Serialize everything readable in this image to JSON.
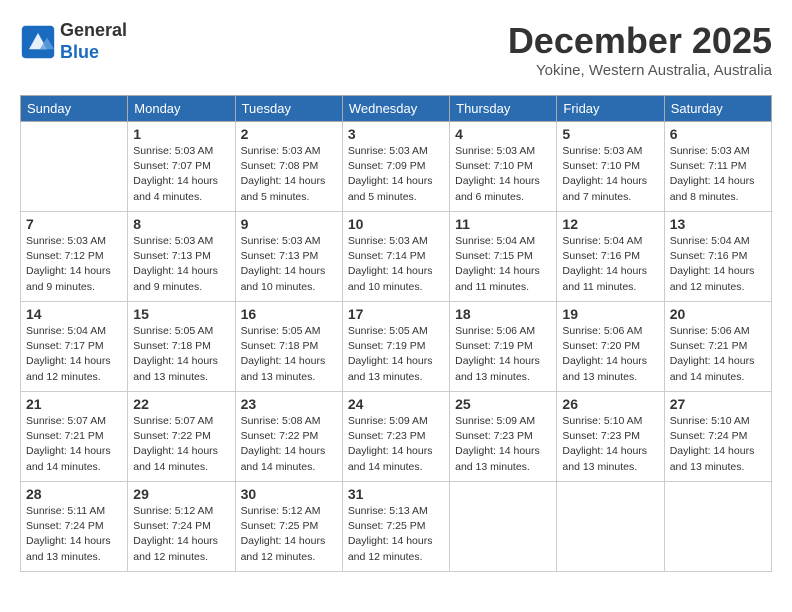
{
  "header": {
    "logo_line1": "General",
    "logo_line2": "Blue",
    "month": "December 2025",
    "location": "Yokine, Western Australia, Australia"
  },
  "weekdays": [
    "Sunday",
    "Monday",
    "Tuesday",
    "Wednesday",
    "Thursday",
    "Friday",
    "Saturday"
  ],
  "weeks": [
    [
      {
        "day": "",
        "info": ""
      },
      {
        "day": "1",
        "info": "Sunrise: 5:03 AM\nSunset: 7:07 PM\nDaylight: 14 hours\nand 4 minutes."
      },
      {
        "day": "2",
        "info": "Sunrise: 5:03 AM\nSunset: 7:08 PM\nDaylight: 14 hours\nand 5 minutes."
      },
      {
        "day": "3",
        "info": "Sunrise: 5:03 AM\nSunset: 7:09 PM\nDaylight: 14 hours\nand 5 minutes."
      },
      {
        "day": "4",
        "info": "Sunrise: 5:03 AM\nSunset: 7:10 PM\nDaylight: 14 hours\nand 6 minutes."
      },
      {
        "day": "5",
        "info": "Sunrise: 5:03 AM\nSunset: 7:10 PM\nDaylight: 14 hours\nand 7 minutes."
      },
      {
        "day": "6",
        "info": "Sunrise: 5:03 AM\nSunset: 7:11 PM\nDaylight: 14 hours\nand 8 minutes."
      }
    ],
    [
      {
        "day": "7",
        "info": ""
      },
      {
        "day": "8",
        "info": "Sunrise: 5:03 AM\nSunset: 7:13 PM\nDaylight: 14 hours\nand 9 minutes."
      },
      {
        "day": "9",
        "info": "Sunrise: 5:03 AM\nSunset: 7:13 PM\nDaylight: 14 hours\nand 10 minutes."
      },
      {
        "day": "10",
        "info": "Sunrise: 5:03 AM\nSunset: 7:14 PM\nDaylight: 14 hours\nand 10 minutes."
      },
      {
        "day": "11",
        "info": "Sunrise: 5:04 AM\nSunset: 7:15 PM\nDaylight: 14 hours\nand 11 minutes."
      },
      {
        "day": "12",
        "info": "Sunrise: 5:04 AM\nSunset: 7:16 PM\nDaylight: 14 hours\nand 11 minutes."
      },
      {
        "day": "13",
        "info": "Sunrise: 5:04 AM\nSunset: 7:16 PM\nDaylight: 14 hours\nand 12 minutes."
      }
    ],
    [
      {
        "day": "14",
        "info": ""
      },
      {
        "day": "15",
        "info": "Sunrise: 5:05 AM\nSunset: 7:18 PM\nDaylight: 14 hours\nand 13 minutes."
      },
      {
        "day": "16",
        "info": "Sunrise: 5:05 AM\nSunset: 7:18 PM\nDaylight: 14 hours\nand 13 minutes."
      },
      {
        "day": "17",
        "info": "Sunrise: 5:05 AM\nSunset: 7:19 PM\nDaylight: 14 hours\nand 13 minutes."
      },
      {
        "day": "18",
        "info": "Sunrise: 5:06 AM\nSunset: 7:19 PM\nDaylight: 14 hours\nand 13 minutes."
      },
      {
        "day": "19",
        "info": "Sunrise: 5:06 AM\nSunset: 7:20 PM\nDaylight: 14 hours\nand 13 minutes."
      },
      {
        "day": "20",
        "info": "Sunrise: 5:06 AM\nSunset: 7:21 PM\nDaylight: 14 hours\nand 14 minutes."
      }
    ],
    [
      {
        "day": "21",
        "info": ""
      },
      {
        "day": "22",
        "info": "Sunrise: 5:07 AM\nSunset: 7:22 PM\nDaylight: 14 hours\nand 14 minutes."
      },
      {
        "day": "23",
        "info": "Sunrise: 5:08 AM\nSunset: 7:22 PM\nDaylight: 14 hours\nand 14 minutes."
      },
      {
        "day": "24",
        "info": "Sunrise: 5:09 AM\nSunset: 7:23 PM\nDaylight: 14 hours\nand 14 minutes."
      },
      {
        "day": "25",
        "info": "Sunrise: 5:09 AM\nSunset: 7:23 PM\nDaylight: 14 hours\nand 13 minutes."
      },
      {
        "day": "26",
        "info": "Sunrise: 5:10 AM\nSunset: 7:23 PM\nDaylight: 14 hours\nand 13 minutes."
      },
      {
        "day": "27",
        "info": "Sunrise: 5:10 AM\nSunset: 7:24 PM\nDaylight: 14 hours\nand 13 minutes."
      }
    ],
    [
      {
        "day": "28",
        "info": "Sunrise: 5:11 AM\nSunset: 7:24 PM\nDaylight: 14 hours\nand 13 minutes."
      },
      {
        "day": "29",
        "info": "Sunrise: 5:12 AM\nSunset: 7:24 PM\nDaylight: 14 hours\nand 12 minutes."
      },
      {
        "day": "30",
        "info": "Sunrise: 5:12 AM\nSunset: 7:25 PM\nDaylight: 14 hours\nand 12 minutes."
      },
      {
        "day": "31",
        "info": "Sunrise: 5:13 AM\nSunset: 7:25 PM\nDaylight: 14 hours\nand 12 minutes."
      },
      {
        "day": "",
        "info": ""
      },
      {
        "day": "",
        "info": ""
      },
      {
        "day": "",
        "info": ""
      }
    ]
  ],
  "week1_day7_info": "Sunrise: 5:03 AM\nSunset: 7:12 PM\nDaylight: 14 hours\nand 9 minutes.",
  "week3_day14_info": "Sunrise: 5:04 AM\nSunset: 7:17 PM\nDaylight: 14 hours\nand 12 minutes.",
  "week4_day21_info": "Sunrise: 5:07 AM\nSunset: 7:21 PM\nDaylight: 14 hours\nand 14 minutes."
}
